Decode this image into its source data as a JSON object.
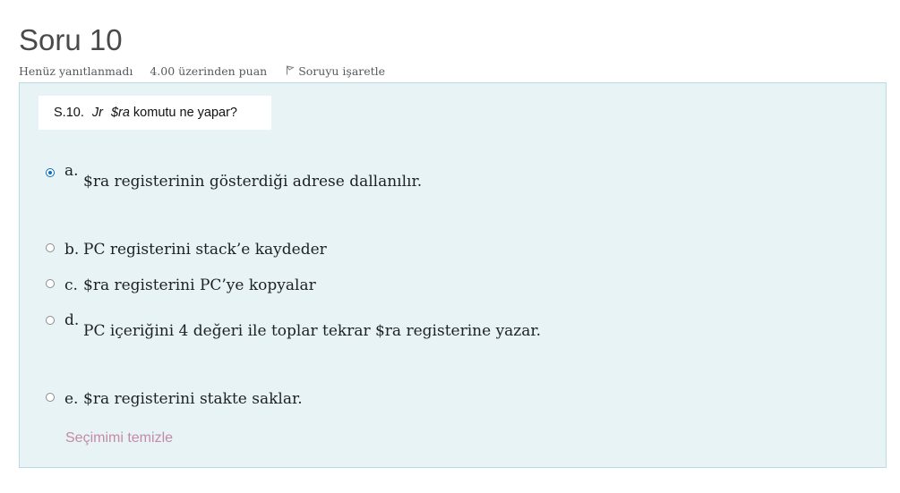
{
  "question": {
    "title": "Soru 10",
    "status": "Henüz yanıtlanmadı",
    "grade": "4.00 üzerinden puan",
    "flag_label": "Soruyu işaretle"
  },
  "prompt_image": {
    "number": "S.10.",
    "instruction": "Jr",
    "register": "$ra",
    "text": "komutu ne yapar?"
  },
  "answers": [
    {
      "letter": "a.",
      "text": "$ra registerinin gösterdiği adrese dallanılır.",
      "selected": true
    },
    {
      "letter": "b.",
      "text": "PC registerini stack’e kaydeder",
      "selected": false
    },
    {
      "letter": "c.",
      "text": "$ra registerini PC’ye kopyalar",
      "selected": false
    },
    {
      "letter": "d.",
      "text": "PC içeriğini 4 değeri ile toplar tekrar $ra registerine yazar.",
      "selected": false
    },
    {
      "letter": "e.",
      "text": "$ra registerini stakte saklar.",
      "selected": false
    }
  ],
  "clear_choice": "Seçimimi temizle",
  "colors": {
    "box_background": "#e7f3f5",
    "box_border": "#b8dce2",
    "selected_radio": "#0f6cbf",
    "clear_link": "#c48aa7"
  }
}
